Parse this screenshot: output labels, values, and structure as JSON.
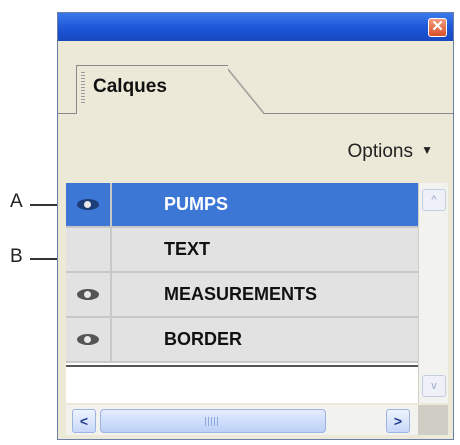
{
  "callouts": {
    "a": "A",
    "b": "B"
  },
  "panel": {
    "close_glyph": "✕",
    "tab_label": "Calques",
    "options_label": "Options",
    "options_arrow": "▼"
  },
  "layers": [
    {
      "name": "PUMPS",
      "visible": true,
      "selected": true
    },
    {
      "name": "TEXT",
      "visible": false,
      "selected": false
    },
    {
      "name": "MEASUREMENTS",
      "visible": true,
      "selected": false
    },
    {
      "name": "BORDER",
      "visible": true,
      "selected": false
    }
  ],
  "scroll": {
    "left": "<",
    "right": ">",
    "up": "^",
    "down": "v"
  },
  "colors": {
    "titlebar": "#1c55d6",
    "selection": "#3c77d6",
    "panel_bg": "#ece9d8"
  }
}
